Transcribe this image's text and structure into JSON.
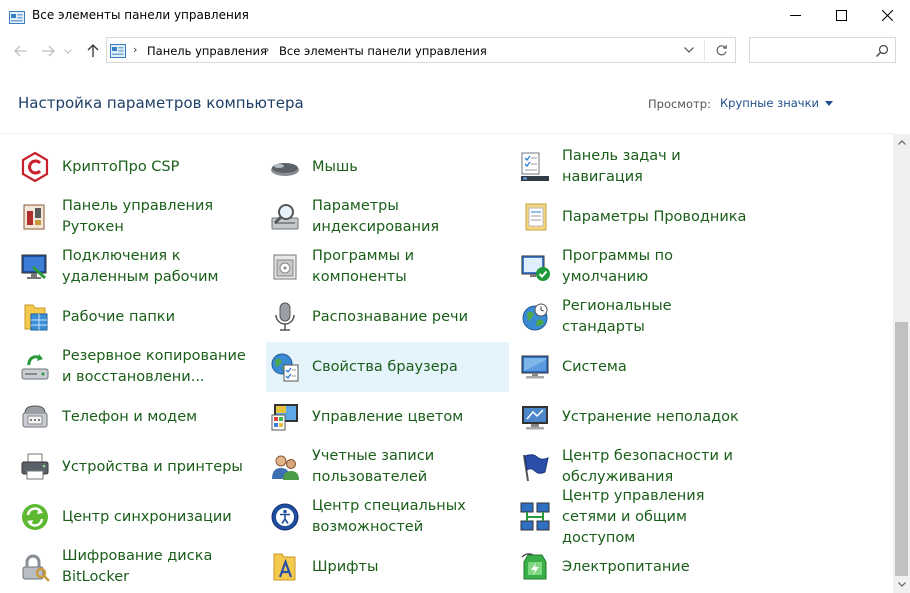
{
  "window": {
    "title": "Все элементы панели управления"
  },
  "address": {
    "crumbs": [
      "Панель управления",
      "Все элементы панели управления"
    ]
  },
  "search": {
    "placeholder": "",
    "value": ""
  },
  "header": {
    "title": "Настройка параметров компьютера",
    "view_label": "Просмотр:",
    "view_value": "Крупные значки"
  },
  "colors": {
    "link_green": "#1a5e1a",
    "title_blue": "#1e3f66",
    "selected_bg": "#e5f3fb"
  },
  "items": [
    {
      "label": "КриптоПро CSP",
      "icon": "cryptopro-icon"
    },
    {
      "label": "Мышь",
      "icon": "mouse-icon"
    },
    {
      "label": "Панель задач и навигация",
      "icon": "taskbar-icon"
    },
    {
      "label": "Панель управления Рутокен",
      "icon": "rutoken-icon"
    },
    {
      "label": "Параметры индексирования",
      "icon": "indexing-icon"
    },
    {
      "label": "Параметры Проводника",
      "icon": "explorer-options-icon"
    },
    {
      "label": "Подключения к удаленным рабочим",
      "icon": "remote-desktop-icon"
    },
    {
      "label": "Программы и компоненты",
      "icon": "programs-icon"
    },
    {
      "label": "Программы по умолчанию",
      "icon": "default-programs-icon"
    },
    {
      "label": "Рабочие папки",
      "icon": "work-folders-icon"
    },
    {
      "label": "Распознавание речи",
      "icon": "microphone-icon"
    },
    {
      "label": "Региональные стандарты",
      "icon": "region-icon"
    },
    {
      "label": "Резервное копирование и восстановлени...",
      "icon": "backup-icon"
    },
    {
      "label": "Свойства браузера",
      "icon": "browser-properties-icon",
      "selected": true
    },
    {
      "label": "Система",
      "icon": "system-icon"
    },
    {
      "label": "Телефон и модем",
      "icon": "phone-modem-icon"
    },
    {
      "label": "Управление цветом",
      "icon": "color-management-icon"
    },
    {
      "label": "Устранение неполадок",
      "icon": "troubleshooting-icon"
    },
    {
      "label": "Устройства и принтеры",
      "icon": "printer-icon"
    },
    {
      "label": "Учетные записи пользователей",
      "icon": "user-accounts-icon"
    },
    {
      "label": "Центр безопасности и обслуживания",
      "icon": "security-flag-icon"
    },
    {
      "label": "Центр синхронизации",
      "icon": "sync-icon"
    },
    {
      "label": "Центр специальных возможностей",
      "icon": "accessibility-icon"
    },
    {
      "label": "Центр управления сетями и общим доступом",
      "icon": "network-icon"
    },
    {
      "label": "Шифрование диска BitLocker",
      "icon": "bitlocker-icon"
    },
    {
      "label": "Шрифты",
      "icon": "fonts-icon"
    },
    {
      "label": "Электропитание",
      "icon": "power-icon"
    }
  ]
}
